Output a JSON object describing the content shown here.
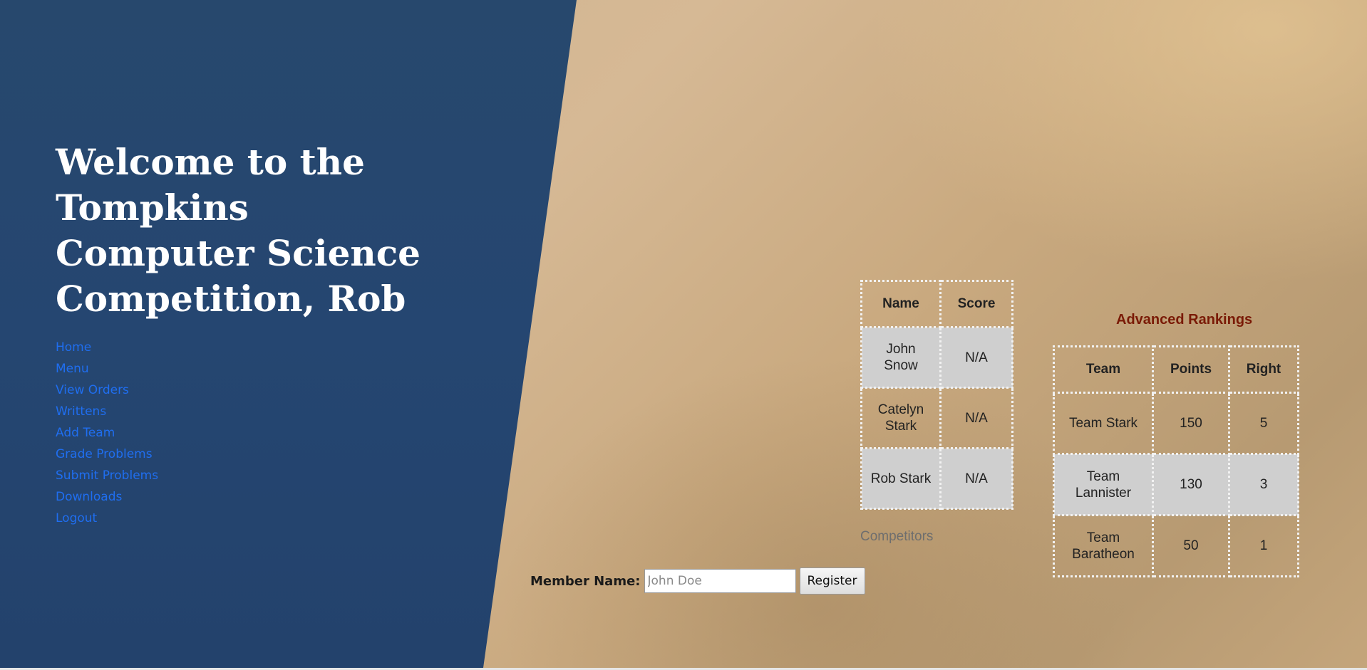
{
  "header": {
    "welcome": "Welcome to the Tompkins Computer Science Competition, Rob"
  },
  "nav": {
    "items": [
      "Home",
      "Menu",
      "View Orders",
      "Writtens",
      "Add Team",
      "Grade Problems",
      "Submit Problems",
      "Downloads",
      "Logout"
    ]
  },
  "competitors": {
    "headers": [
      "Name",
      "Score"
    ],
    "rows": [
      [
        "John Snow",
        "N/A"
      ],
      [
        "Catelyn Stark",
        "N/A"
      ],
      [
        "Rob Stark",
        "N/A"
      ]
    ],
    "caption": "Competitors"
  },
  "advanced_rankings": {
    "title": "Advanced Rankings",
    "headers": [
      "Team",
      "Points",
      "Right"
    ],
    "rows": [
      [
        "Team Stark",
        "150",
        "5"
      ],
      [
        "Team Lannister",
        "130",
        "3"
      ],
      [
        "Team Baratheon",
        "50",
        "1"
      ]
    ]
  },
  "register_form": {
    "label": "Member Name:",
    "placeholder": "John Doe",
    "button": "Register"
  },
  "colors": {
    "panel": "#254671",
    "link": "#1f6ef0",
    "rankings_title": "#7a1a06",
    "shaded_row": "#cfcfcf"
  }
}
